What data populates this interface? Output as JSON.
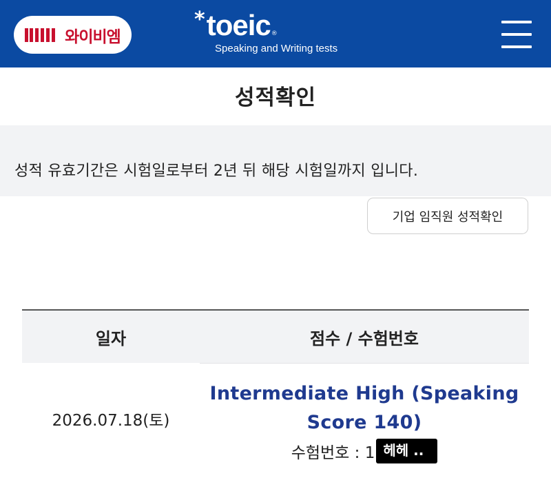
{
  "header": {
    "ybm_logo_text": "와이비엠",
    "toeic_star": "*",
    "toeic_name": "toeic",
    "toeic_reg": "®",
    "toeic_subtitle": "Speaking and Writing tests",
    "menu_icon": "hamburger-menu-icon",
    "background_color": "#0b4aa2",
    "ybm_brand_color": "#c8102e"
  },
  "page": {
    "title": "성적확인",
    "notice": "성적 유효기간은 시험일로부터 2년 뒤 해당 시험일까지 입니다.",
    "corporate_button_label": "기업 임직원 성적확인"
  },
  "table": {
    "headers": {
      "date": "일자",
      "score": "점수 / 수험번호"
    },
    "rows": [
      {
        "date": "2026.07.18(토)",
        "level": "Intermediate High (Speaking Score 140)",
        "test_number_label": "수험번호 : 1",
        "redacted_overlay": "헤헤 .."
      }
    ],
    "level_color": "#1f3a8f"
  }
}
